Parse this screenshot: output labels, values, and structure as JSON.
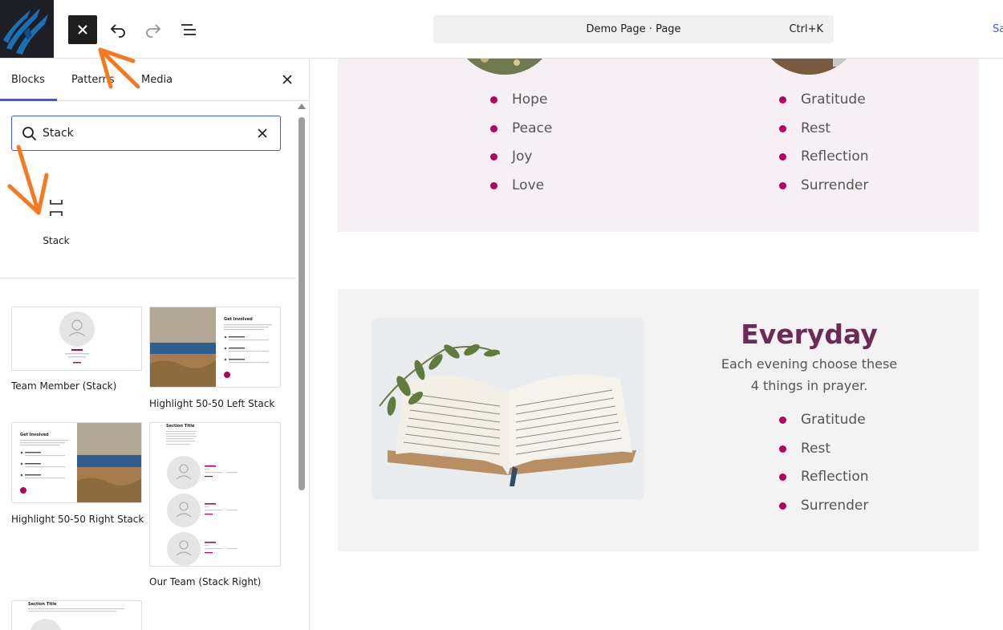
{
  "header": {
    "command_title": "Demo Page · Page",
    "command_shortcut": "Ctrl+K",
    "save_label": "Sa"
  },
  "inserter": {
    "tabs": [
      {
        "label": "Blocks",
        "active": true
      },
      {
        "label": "Patterns",
        "active": false
      },
      {
        "label": "Media",
        "active": false
      }
    ],
    "search": {
      "value": "Stack",
      "placeholder": "Search"
    },
    "block_result": {
      "label": "Stack",
      "icon": "stack-icon"
    },
    "patterns": [
      {
        "label": "Team Member (Stack)"
      },
      {
        "label": "Highlight 50-50 Left Stack"
      },
      {
        "label": "Highlight 50-50 Right Stack"
      },
      {
        "label": "Our Team (Stack Right)"
      },
      {
        "label": ""
      }
    ],
    "thumb_text": {
      "get_involved": "Get Involved",
      "section_title": "Section Title",
      "first_last": "First Last"
    }
  },
  "canvas": {
    "list_left": [
      "Hope",
      "Peace",
      "Joy",
      "Love"
    ],
    "list_right": [
      "Gratitude",
      "Rest",
      "Reflection",
      "Surrender"
    ],
    "everyday": {
      "heading": "Everyday",
      "subtext_line1": "Each evening choose these",
      "subtext_line2": "4 things in prayer.",
      "list": [
        "Gratitude",
        "Rest",
        "Reflection",
        "Surrender"
      ]
    }
  },
  "colors": {
    "accent": "#3858e9",
    "bullet": "#b5005e",
    "heading": "#6e2a55",
    "annotation": "#f47920"
  }
}
